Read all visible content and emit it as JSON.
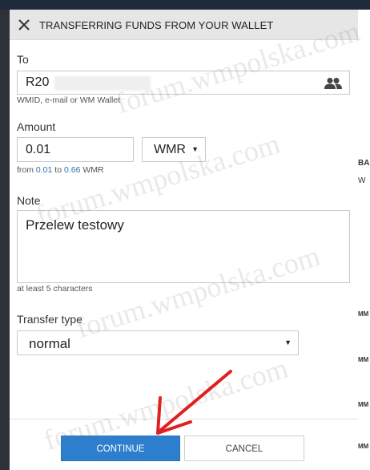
{
  "dialog": {
    "title": "TRANSFERRING FUNDS FROM YOUR WALLET"
  },
  "to": {
    "label": "To",
    "value": "R20",
    "hint": "WMID, e-mail or WM Wallet"
  },
  "amount": {
    "label": "Amount",
    "value": "0.01",
    "currency": "WMR",
    "hint_from": "from",
    "hint_min": "0.01",
    "hint_to": "to",
    "hint_max": "0.66",
    "hint_unit": "WMR"
  },
  "note": {
    "label": "Note",
    "value": "Przelew testowy",
    "hint": "at least 5 characters"
  },
  "transfer_type": {
    "label": "Transfer type",
    "value": "normal"
  },
  "buttons": {
    "continue": "CONTINUE",
    "cancel": "CANCEL"
  },
  "background": {
    "right_fragments": [
      "BA",
      "W",
      "MM",
      "MM",
      "MM",
      "MM"
    ]
  },
  "watermark": "forum.wmpolska.com",
  "colors": {
    "primary": "#2d7fce",
    "arrow": "#e02020",
    "header_bg": "#e6e6e6"
  },
  "icons": {
    "close": "close-icon",
    "contacts": "contacts-icon",
    "caret": "chevron-down-icon"
  }
}
